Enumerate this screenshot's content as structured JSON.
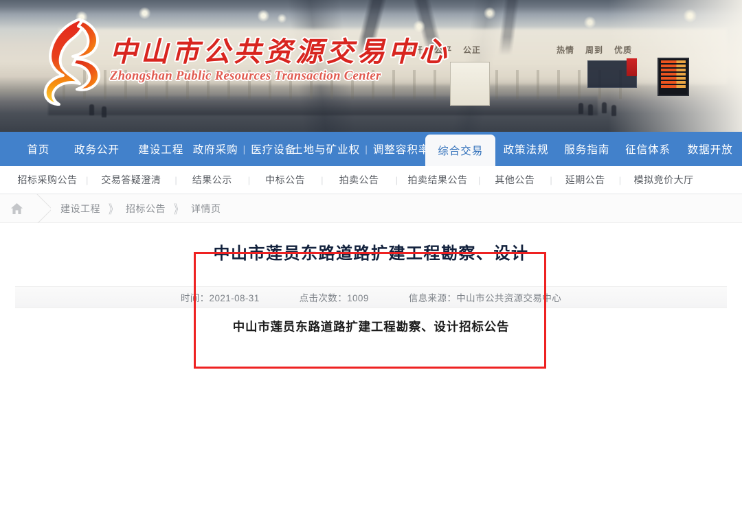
{
  "banner": {
    "logo_icon": "flame-ribbon-logo",
    "title_cn": "中山市公共资源交易中心",
    "title_en": "Zhongshan Public Resources Transaction Center",
    "wall_motto_left": [
      "公开",
      "公平",
      "公正"
    ],
    "wall_motto_right": [
      "热情",
      "周到",
      "优质"
    ]
  },
  "mainnav": {
    "items": [
      {
        "label": "首页",
        "active": false
      },
      {
        "label": "政务公开",
        "active": false
      },
      {
        "label": "建设工程",
        "active": false
      },
      {
        "label": "政府采购",
        "label2": "医疗设备",
        "separator": "|",
        "active": false
      },
      {
        "label": "土地与矿业权",
        "label2": "调整容积率",
        "separator": "|",
        "active": false
      },
      {
        "label": "综合交易",
        "active": true
      },
      {
        "label": "政策法规",
        "active": false
      },
      {
        "label": "服务指南",
        "active": false
      },
      {
        "label": "征信体系",
        "active": false
      },
      {
        "label": "数据开放",
        "active": false
      }
    ],
    "bg_color": "#4281CB",
    "active_bg": "#F7F8FA",
    "active_text": "#2F6FBA"
  },
  "subnav": {
    "separator": "|",
    "items": [
      {
        "label": "招标采购公告"
      },
      {
        "label": "交易答疑澄清"
      },
      {
        "label": "结果公示"
      },
      {
        "label": "中标公告"
      },
      {
        "label": "拍卖公告"
      },
      {
        "label": "拍卖结果公告"
      },
      {
        "label": "其他公告"
      },
      {
        "label": "延期公告"
      },
      {
        "label": "模拟竞价大厅"
      }
    ]
  },
  "breadcrumb": {
    "home_icon": "home-icon",
    "chevron": "》",
    "items": [
      "建设工程",
      "招标公告",
      "详情页"
    ]
  },
  "article": {
    "title": "中山市莲员东路道路扩建工程勘察、设计",
    "meta": {
      "time": "时间：2021-08-31",
      "views": "点击次数：1009",
      "source": "信息来源：中山市公共资源交易中心"
    },
    "body": "中山市莲员东路道路扩建工程勘察、设计招标公告"
  },
  "annotation": {
    "type": "red-rectangle-highlight",
    "color": "#EE2222"
  }
}
